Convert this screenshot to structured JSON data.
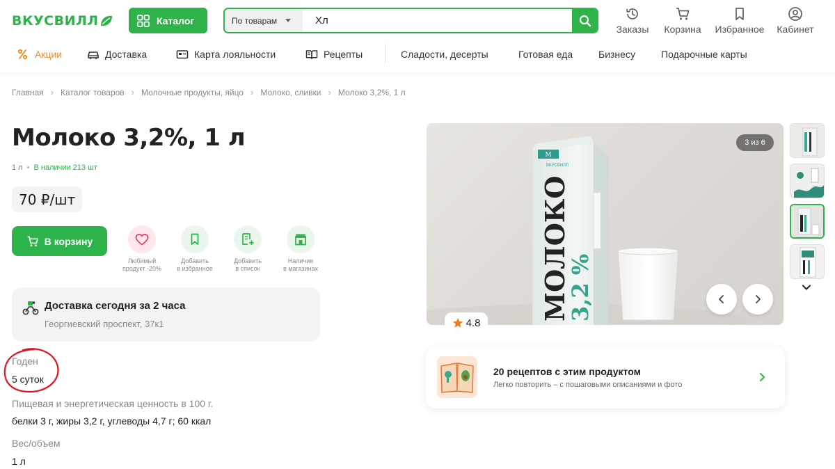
{
  "header": {
    "logo": "ВКУСВИЛЛ",
    "catalog_label": "Каталог",
    "search_scope": "По товарам",
    "search_value": "Хл",
    "icons": [
      {
        "label": "Заказы",
        "icon": "history-icon"
      },
      {
        "label": "Корзина",
        "icon": "cart-icon"
      },
      {
        "label": "Избранное",
        "icon": "bookmark-icon"
      },
      {
        "label": "Кабинет",
        "icon": "user-icon"
      }
    ]
  },
  "nav": [
    {
      "label": "Акции",
      "icon": "percent-icon"
    },
    {
      "label": "Доставка",
      "icon": "car-icon"
    },
    {
      "label": "Карта лояльности",
      "icon": "card-icon"
    },
    {
      "label": "Рецепты",
      "icon": "book-icon"
    },
    {
      "label": "Сладости, десерты"
    },
    {
      "label": "Готовая еда"
    },
    {
      "label": "Бизнесу"
    },
    {
      "label": "Подарочные карты"
    }
  ],
  "breadcrumb": [
    "Главная",
    "Каталог товаров",
    "Молочные продукты, яйцо",
    "Молоко, сливки",
    "Молоко 3,2%, 1 л"
  ],
  "product": {
    "title": "Молоко 3,2%, 1 л",
    "volume": "1 л",
    "stock": "В наличии 213 шт",
    "price": "70 ₽/шт",
    "cart_label": "В корзину",
    "actions": [
      {
        "line1": "Любимый",
        "line2": "продукт -20%",
        "icon": "heart-icon"
      },
      {
        "line1": "Добавить",
        "line2": "в избранное",
        "icon": "bookmark-icon"
      },
      {
        "line1": "Добавить",
        "line2": "в список",
        "icon": "list-add-icon"
      },
      {
        "line1": "Наличие",
        "line2": "в магазинах",
        "icon": "store-icon"
      }
    ],
    "delivery": {
      "title": "Доставка сегодня за 2 часа",
      "address": "Георгиевский проспект, 37к1"
    },
    "specs": [
      {
        "label": "Годен",
        "value": "5 суток"
      },
      {
        "label": "Пищевая и энергетическая ценность в 100 г.",
        "value": "белки 3 г, жиры 3,2 г, углеводы 4,7 г; 60 ккал"
      },
      {
        "label": "Вес/объем",
        "value": "1 л"
      }
    ]
  },
  "gallery": {
    "counter": "3 из 6",
    "rating": "4.8",
    "carton_brand": "ВКУСВИЛЛ",
    "carton_text": "МОЛОКО",
    "carton_percent": "3,2 %"
  },
  "recipes": {
    "title": "20 рецептов с этим продуктом",
    "subtitle": "Легко повторить – с пошаговыми описаниями и фото"
  },
  "colors": {
    "brand": "#2eb34b",
    "promo": "#f08a24",
    "annotation": "#e0141e"
  }
}
